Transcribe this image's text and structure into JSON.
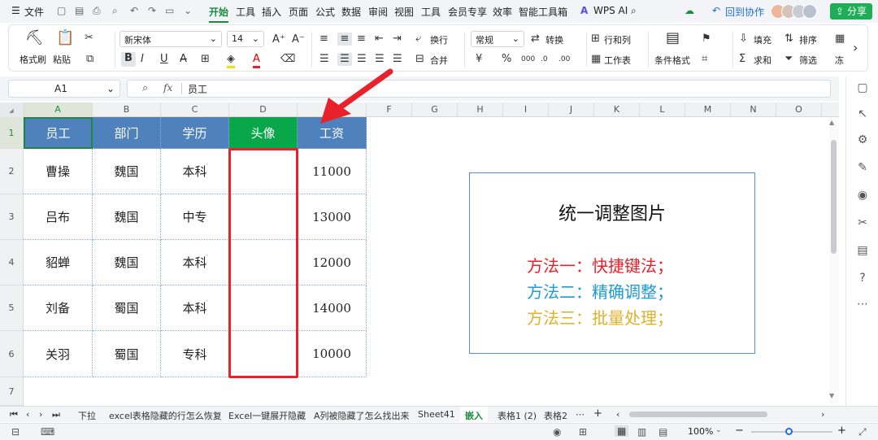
{
  "menu": {
    "file": "文件",
    "tabs": [
      "开始",
      "工具",
      "插入",
      "页面",
      "公式",
      "数据",
      "审阅",
      "视图",
      "工具",
      "会员专享",
      "效率",
      "智能工具箱"
    ],
    "wps_ai": "WPS AI",
    "back_collab": "回到协作",
    "share": "分享"
  },
  "ribbon": {
    "format_painter": "格式刷",
    "paste": "粘贴",
    "font_name": "新宋体",
    "font_size": "14",
    "wrap": "换行",
    "merge": "合并",
    "number_format": "常规",
    "convert": "转换",
    "row_col": "行和列",
    "worksheet": "工作表",
    "cond_format": "条件格式",
    "fill": "填充",
    "sort": "排序",
    "sum": "求和",
    "filter": "筛选",
    "freeze": "冻"
  },
  "formula_bar": {
    "cell_ref": "A1",
    "fx": "fx",
    "content": "员工"
  },
  "columns": [
    "A",
    "B",
    "C",
    "D",
    "E",
    "F",
    "G",
    "H",
    "I",
    "J",
    "K",
    "L",
    "M",
    "N",
    "O"
  ],
  "rows": [
    "1",
    "2",
    "3",
    "4",
    "5",
    "6",
    "7"
  ],
  "table": {
    "headers": [
      "员工",
      "部门",
      "学历",
      "头像",
      "工资"
    ],
    "data": [
      [
        "曹操",
        "魏国",
        "本科",
        "",
        "11000"
      ],
      [
        "吕布",
        "魏国",
        "中专",
        "",
        "13000"
      ],
      [
        "貂蝉",
        "魏国",
        "本科",
        "",
        "12000"
      ],
      [
        "刘备",
        "蜀国",
        "本科",
        "",
        "14000"
      ],
      [
        "关羽",
        "蜀国",
        "专科",
        "",
        "10000"
      ]
    ]
  },
  "textbox": {
    "title": "统一调整图片",
    "line1": "方法一：快捷键法；",
    "line2": "方法二：精确调整；",
    "line3": "方法三：批量处理；"
  },
  "sheet_tabs": [
    "下拉",
    "excel表格隐藏的行怎么恢复",
    "Excel一键展开隐藏",
    "A列被隐藏了怎么找出来",
    "Sheet41",
    "嵌入",
    "表格1 (2)",
    "表格2"
  ],
  "active_sheet": "嵌入",
  "status": {
    "zoom": "100%"
  },
  "colors": {
    "header_blue": "#4f81bd",
    "header_green": "#0aa64a",
    "method1": "#e8212b",
    "method2": "#1e9ad6",
    "method3": "#e0b02a",
    "arrow": "#e8212b",
    "accent": "#1a8a3e"
  }
}
